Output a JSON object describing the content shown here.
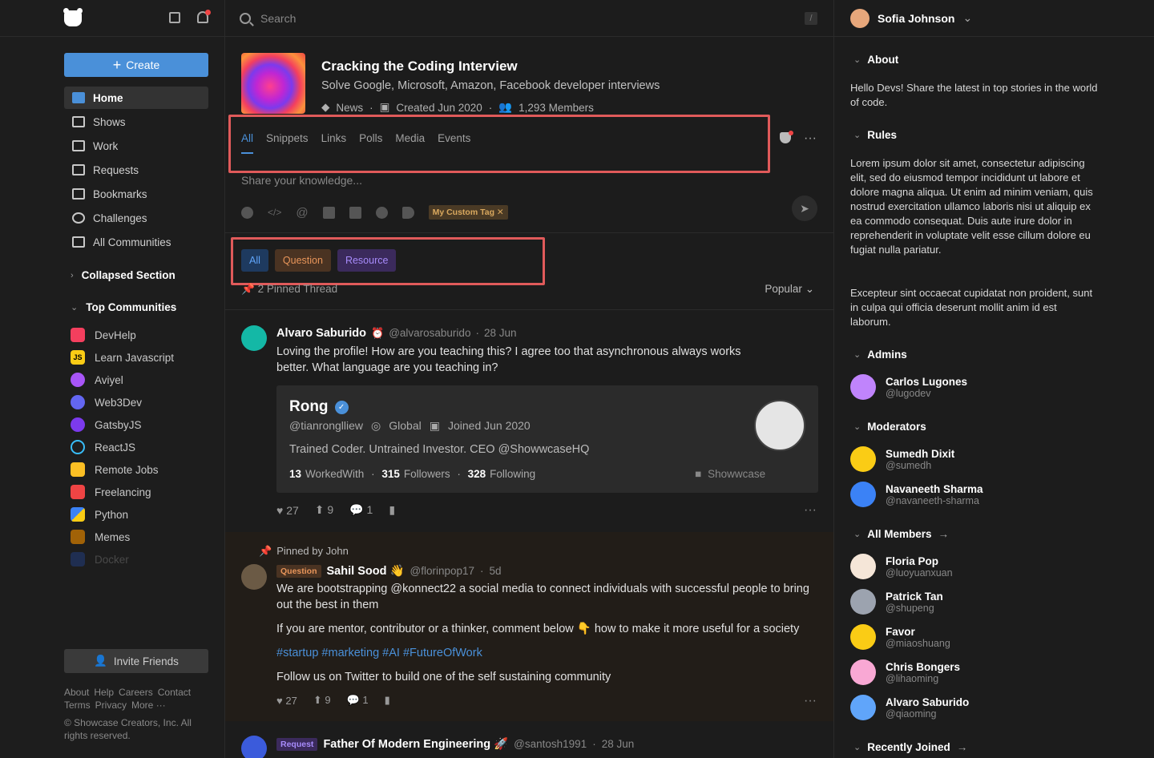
{
  "left": {
    "create_label": "Create",
    "nav": [
      {
        "label": "Home",
        "active": true
      },
      {
        "label": "Shows"
      },
      {
        "label": "Work"
      },
      {
        "label": "Requests"
      },
      {
        "label": "Bookmarks"
      },
      {
        "label": "Challenges"
      },
      {
        "label": "All Communities"
      }
    ],
    "collapsed_section": "Collapsed Section",
    "top_communities": "Top Communities",
    "communities": [
      {
        "label": "DevHelp",
        "color": "#f43f5e"
      },
      {
        "label": "Learn Javascript",
        "color": "#facc15"
      },
      {
        "label": "Aviyel",
        "color": "#a855f7"
      },
      {
        "label": "Web3Dev",
        "color": "#6366f1"
      },
      {
        "label": "GatsbyJS",
        "color": "#7c3aed"
      },
      {
        "label": "ReactJS",
        "color": "#38bdf8"
      },
      {
        "label": "Remote Jobs",
        "color": "#fbbf24"
      },
      {
        "label": "Freelancing",
        "color": "#ef4444"
      },
      {
        "label": "Python",
        "color": "#3b82f6"
      },
      {
        "label": "Memes",
        "color": "#a16207"
      },
      {
        "label": "Docker",
        "color": "#2563eb"
      }
    ],
    "invite_label": "Invite Friends",
    "footer_links": [
      "About",
      "Help",
      "Careers",
      "Contact",
      "Terms",
      "Privacy",
      "More ···"
    ],
    "copyright": "© Showcase Creators, Inc. All rights reserved."
  },
  "search": {
    "placeholder": "Search",
    "shortcut": "/"
  },
  "community": {
    "title": "Cracking the Coding Interview",
    "subtitle": "Solve Google, Microsoft, Amazon, Facebook developer interviews",
    "category": "News",
    "created": "Created Jun 2020",
    "members": "1,293 Members"
  },
  "tabs": [
    "All",
    "Snippets",
    "Links",
    "Polls",
    "Media",
    "Events"
  ],
  "composer": {
    "placeholder": "Share your knowledge...",
    "custom_tag": "My Custom Tag"
  },
  "filters": [
    {
      "label": "All",
      "bg": "#1e3a5f",
      "fg": "#60a5fa"
    },
    {
      "label": "Question",
      "bg": "#4a3322",
      "fg": "#e8955a"
    },
    {
      "label": "Resource",
      "bg": "#3b2a5c",
      "fg": "#a78bfa"
    }
  ],
  "pinned_threads": "2 Pinned Thread",
  "sort": "Popular",
  "post1": {
    "name": "Alvaro Saburido",
    "handle": "@alvarosaburido",
    "time": "28 Jun",
    "text": "Loving the profile! How are you teaching this? I agree too that asynchronous always works better. What language are you teaching in?",
    "card": {
      "name": "Rong",
      "handle": "@tianronglliew",
      "location": "Global",
      "joined": "Joined Jun 2020",
      "bio": "Trained Coder. Untrained Investor. CEO @ShowwcaseHQ",
      "worked_with": "13",
      "worked_with_label": "WorkedWith",
      "followers": "315",
      "followers_label": "Followers",
      "following": "328",
      "following_label": "Following",
      "brand": "Showwcase"
    },
    "likes": "27",
    "boosts": "9",
    "comments": "1"
  },
  "post2": {
    "pinned_by": "Pinned by John",
    "tag": "Question",
    "name": "Sahil Sood 👋",
    "handle": "@florinpop17",
    "time": "5d",
    "text1": "We are bootstrapping @konnect22 a social media to connect individuals with successful people to bring out the best in them",
    "text2": "If you are mentor, contributor or a thinker, comment below 👇 how to make it more useful for a society",
    "hashtags": "#startup #marketing #AI #FutureOfWork",
    "text3": "Follow us on Twitter to build one of the self sustaining community",
    "likes": "27",
    "boosts": "9",
    "comments": "1"
  },
  "post3": {
    "tag": "Request",
    "name": "Father Of Modern Engineering 🚀",
    "handle": "@santosh1991",
    "time": "28 Jun"
  },
  "right": {
    "user": "Sofia Johnson",
    "about_title": "About",
    "about_text": "Hello Devs! Share the latest in top stories in the world of code.",
    "rules_title": "Rules",
    "rules_text1": "Lorem ipsum dolor sit amet, consectetur adipiscing elit, sed do eiusmod tempor incididunt ut labore et dolore magna aliqua. Ut enim ad minim veniam, quis nostrud exercitation ullamco laboris nisi ut aliquip ex ea commodo consequat. Duis aute irure dolor in reprehenderit in voluptate velit esse cillum dolore eu fugiat nulla pariatur.",
    "rules_text2": "Excepteur sint occaecat cupidatat non proident, sunt in culpa qui officia deserunt mollit anim id est laborum.",
    "admins_title": "Admins",
    "admins": [
      {
        "name": "Carlos Lugones",
        "handle": "@lugodev"
      }
    ],
    "moderators_title": "Moderators",
    "moderators": [
      {
        "name": "Sumedh Dixit",
        "handle": "@sumedh"
      },
      {
        "name": "Navaneeth Sharma",
        "handle": "@navaneeth-sharma"
      }
    ],
    "members_title": "All Members",
    "members": [
      {
        "name": "Floria Pop",
        "handle": "@luoyuanxuan"
      },
      {
        "name": "Patrick Tan",
        "handle": "@shupeng"
      },
      {
        "name": "Favor",
        "handle": "@miaoshuang"
      },
      {
        "name": "Chris Bongers",
        "handle": "@lihaoming"
      },
      {
        "name": "Alvaro Saburido",
        "handle": "@qiaoming"
      }
    ],
    "recently_title": "Recently Joined"
  }
}
